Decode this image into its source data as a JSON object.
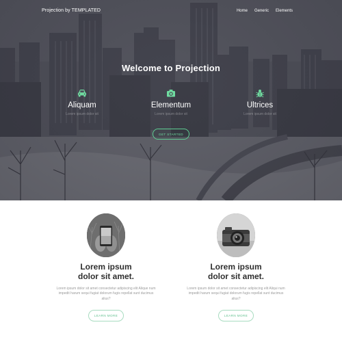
{
  "nav": {
    "brand": "Projection by TEMPLATED",
    "links": [
      "Home",
      "Generic",
      "Elements"
    ]
  },
  "hero": {
    "title": "Welcome to Projection",
    "features": [
      {
        "icon": "car-icon",
        "title": "Aliquam",
        "text": "Lorem ipsum dolor sit"
      },
      {
        "icon": "camera-icon",
        "title": "Elementum",
        "text": "Lorem ipsum dolor sit"
      },
      {
        "icon": "bug-icon",
        "title": "Ultrices",
        "text": "Lorem ipsum dolor sit"
      }
    ],
    "cta_label": "GET STARTED"
  },
  "cards": [
    {
      "photo": "phone-photo",
      "title_line1": "Lorem ipsum",
      "title_line2": "dolor sit amet.",
      "text": "Lorem ipsum dolor sit amet consectetur adipiscing elit Alique num impedit harum sequi fugiat dolorum fugis repellat sunt ducimus alius?",
      "button": "LEARN MORE"
    },
    {
      "photo": "camera-photo",
      "title_line1": "Lorem ipsum",
      "title_line2": "dolor sit amet.",
      "text": "Lorem ipsum dolor sit amet consectetur adipiscing elit Aliqui num impedit harum sequi fugiat dolorum fugis repellat sunt ducimus alius?",
      "button": "LEARN MORE"
    }
  ],
  "colors": {
    "accent": "#6fdca0",
    "hero_overlay": "#4d4e58",
    "card_title": "#2f2f2f",
    "body_text": "#9a9a9a"
  }
}
